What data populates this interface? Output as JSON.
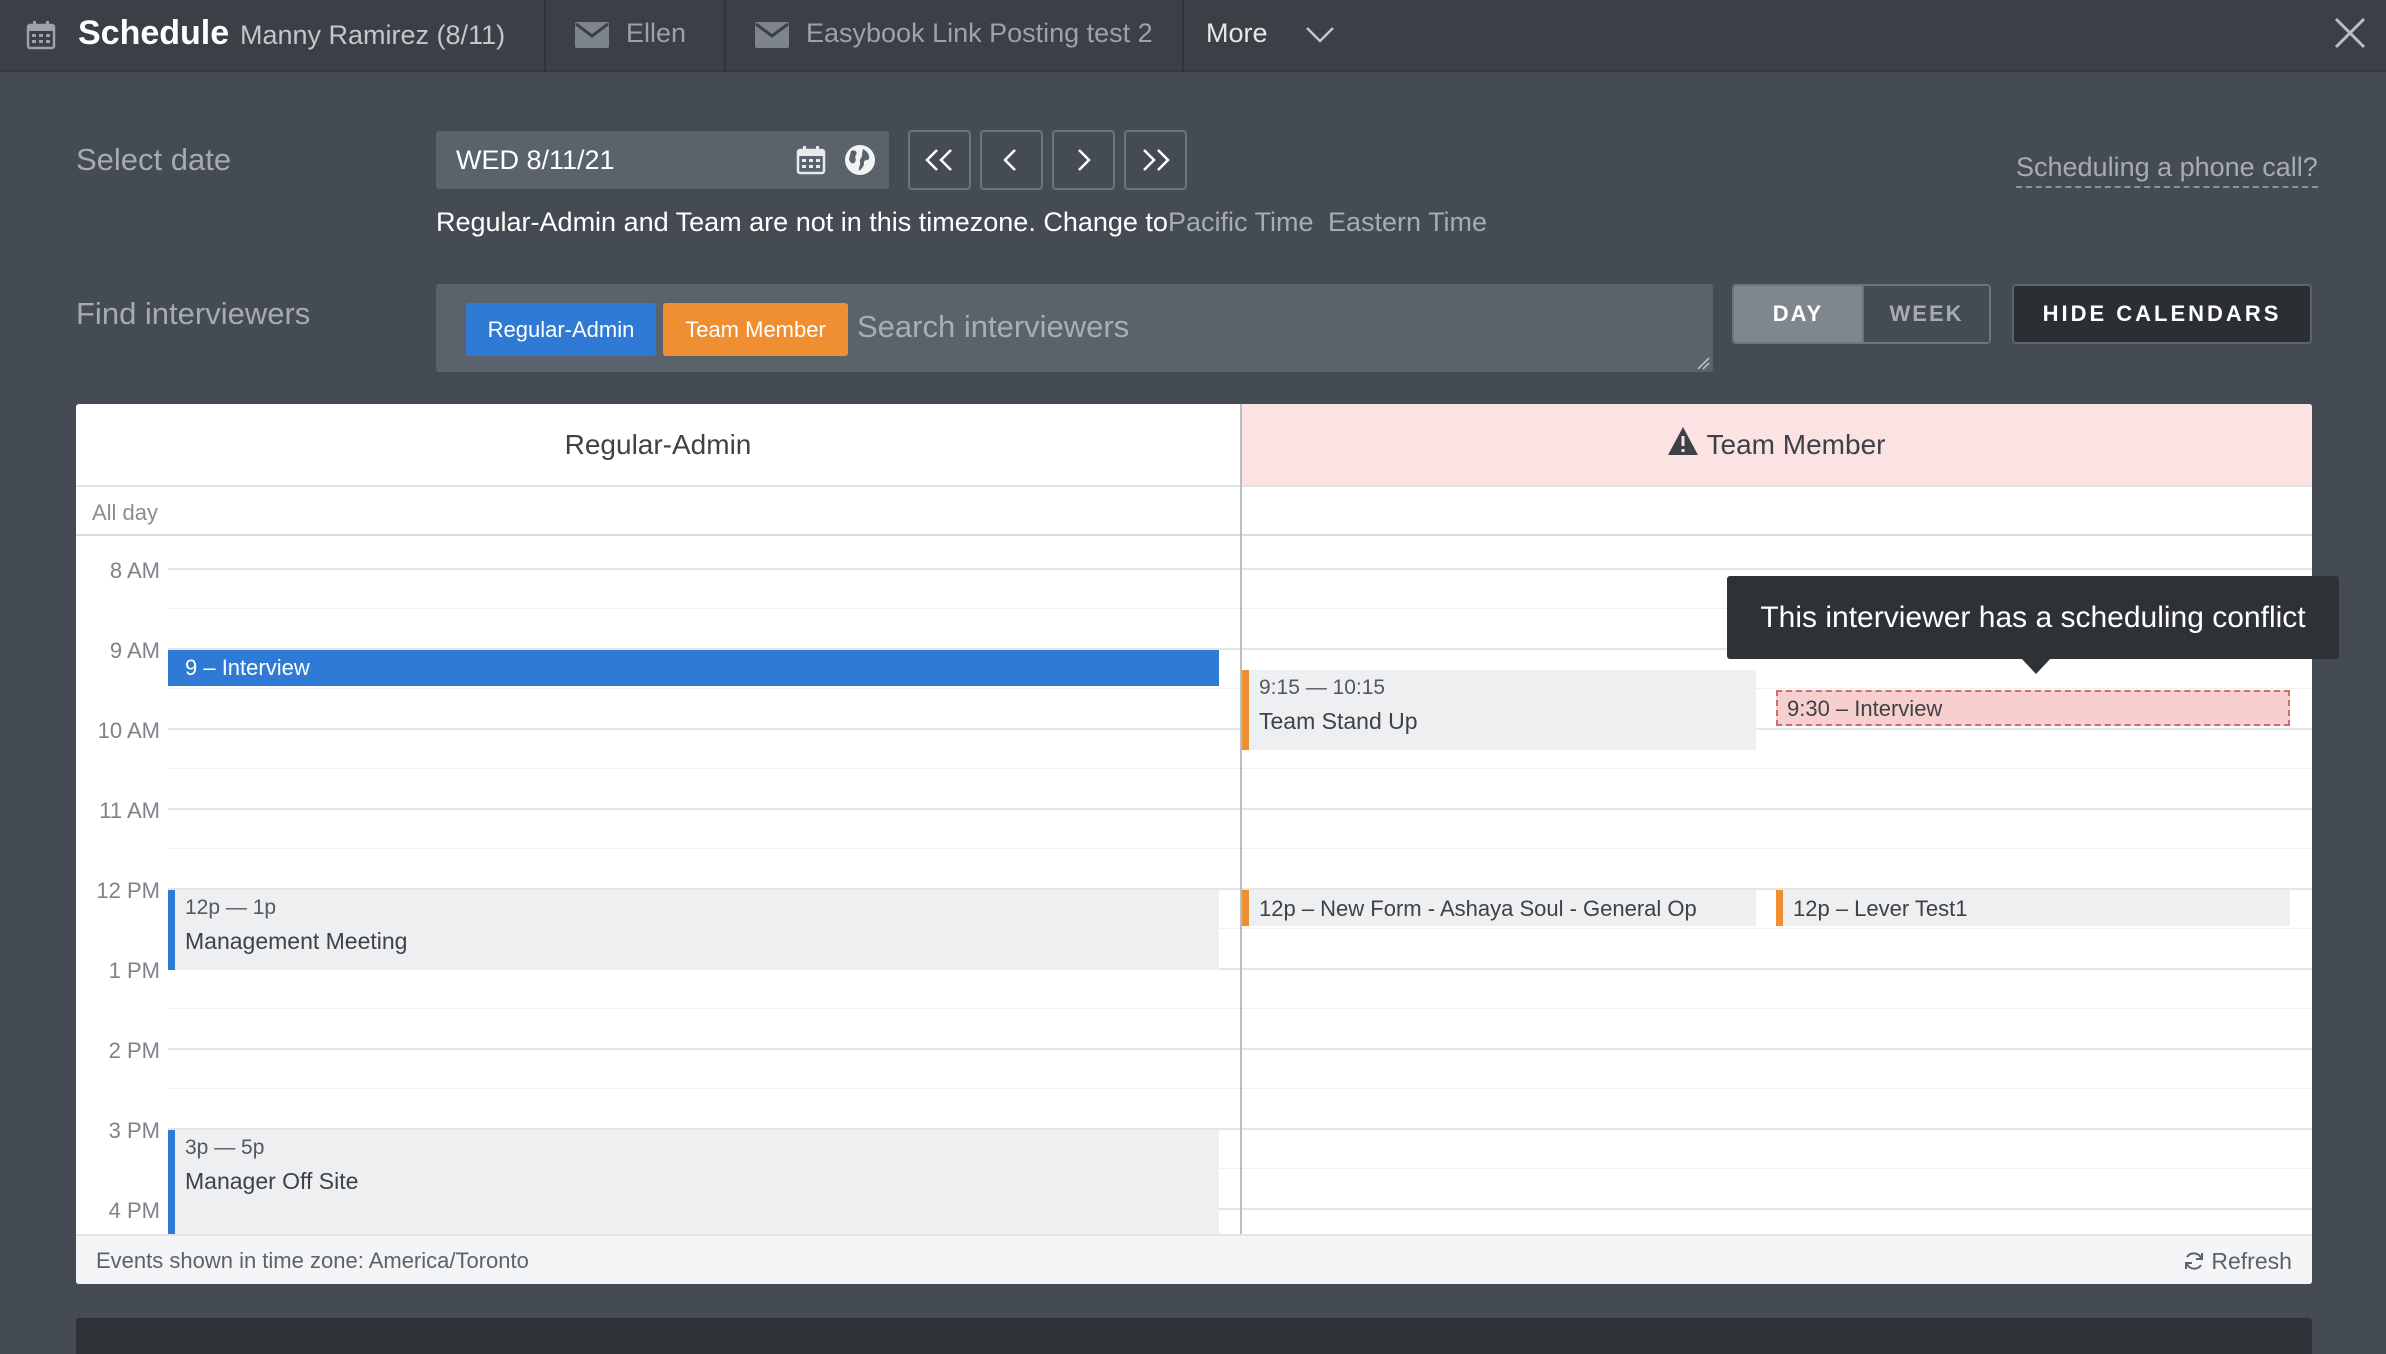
{
  "tabs": {
    "title": "Schedule",
    "subtitle": "Manny Ramirez (8/11)",
    "items": [
      {
        "label": "Ellen",
        "icon": "envelope-icon"
      },
      {
        "label": "Easybook Link Posting test 2",
        "icon": "envelope-icon"
      }
    ],
    "more_label": "More"
  },
  "date_row": {
    "label": "Select date",
    "value": "WED 8/11/21",
    "timezone_note": "Regular-Admin and Team are not in this timezone. Change to",
    "tz_options": [
      "Pacific Time",
      "Eastern Time"
    ],
    "phone_link": "Scheduling a phone call?"
  },
  "find_row": {
    "label": "Find interviewers",
    "chips": [
      "Regular-Admin",
      "Team Member"
    ],
    "search_placeholder": "Search interviewers",
    "view_options": [
      "DAY",
      "WEEK"
    ],
    "active_view": "DAY",
    "hide_calendars_label": "HIDE CALENDARS"
  },
  "calendar": {
    "columns": [
      "Regular-Admin",
      "Team Member"
    ],
    "all_day_label": "All day",
    "hours": [
      "8 AM",
      "9 AM",
      "10 AM",
      "11 AM",
      "12 PM",
      "1 PM",
      "2 PM",
      "3 PM",
      "4 PM"
    ],
    "events": {
      "admin_interview": "9 – Interview",
      "admin_mgmt_time": "12p — 1p",
      "admin_mgmt_title": "Management Meeting",
      "admin_offsite_time": "3p — 5p",
      "admin_offsite_title": "Manager Off Site",
      "team_standup_time": "9:15 — 10:15",
      "team_standup_title": "Team Stand Up",
      "team_interview_conflict": "9:30 – Interview",
      "team_newform": "12p – New Form - Ashaya Soul - General Op",
      "team_levertest": "12p – Lever Test1"
    },
    "conflict_tooltip": "This interviewer has a scheduling conflict",
    "footer_timezone": "Events shown in time zone: America/Toronto",
    "refresh_label": "Refresh"
  },
  "colors": {
    "admin": "#2f7ad4",
    "team": "#ef8f32",
    "conflict_bg": "#f7cfcf"
  }
}
